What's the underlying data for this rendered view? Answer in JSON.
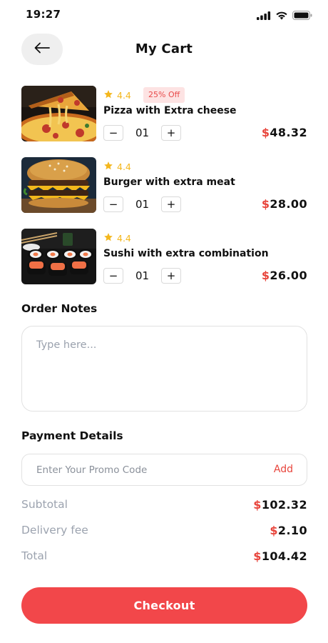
{
  "status": {
    "time": "19:27"
  },
  "header": {
    "title": "My Cart"
  },
  "cart": {
    "items": [
      {
        "rating": "4.4",
        "badge": "25% Off",
        "name": "Pizza with Extra cheese",
        "qty": "01",
        "currency": "$",
        "price": "48.32"
      },
      {
        "rating": "4.4",
        "name": "Burger with extra meat",
        "qty": "01",
        "currency": "$",
        "price": "28.00"
      },
      {
        "rating": "4.4",
        "name": "Sushi with extra combination",
        "qty": "01",
        "currency": "$",
        "price": "26.00"
      }
    ],
    "minus_label": "−",
    "plus_label": "+"
  },
  "notes": {
    "title": "Order Notes",
    "placeholder": "Type here..."
  },
  "payment": {
    "title": "Payment Details",
    "promo_placeholder": "Enter Your Promo Code",
    "promo_add": "Add",
    "rows": [
      {
        "label": "Subtotal",
        "currency": "$",
        "value": "102.32"
      },
      {
        "label": "Delivery fee",
        "currency": "$",
        "value": "2.10"
      },
      {
        "label": "Total",
        "currency": "$",
        "value": "104.42"
      }
    ]
  },
  "checkout": {
    "label": "Checkout"
  },
  "colors": {
    "accent": "#f2474a",
    "star": "#f4b71e",
    "muted": "#9ca3af"
  }
}
